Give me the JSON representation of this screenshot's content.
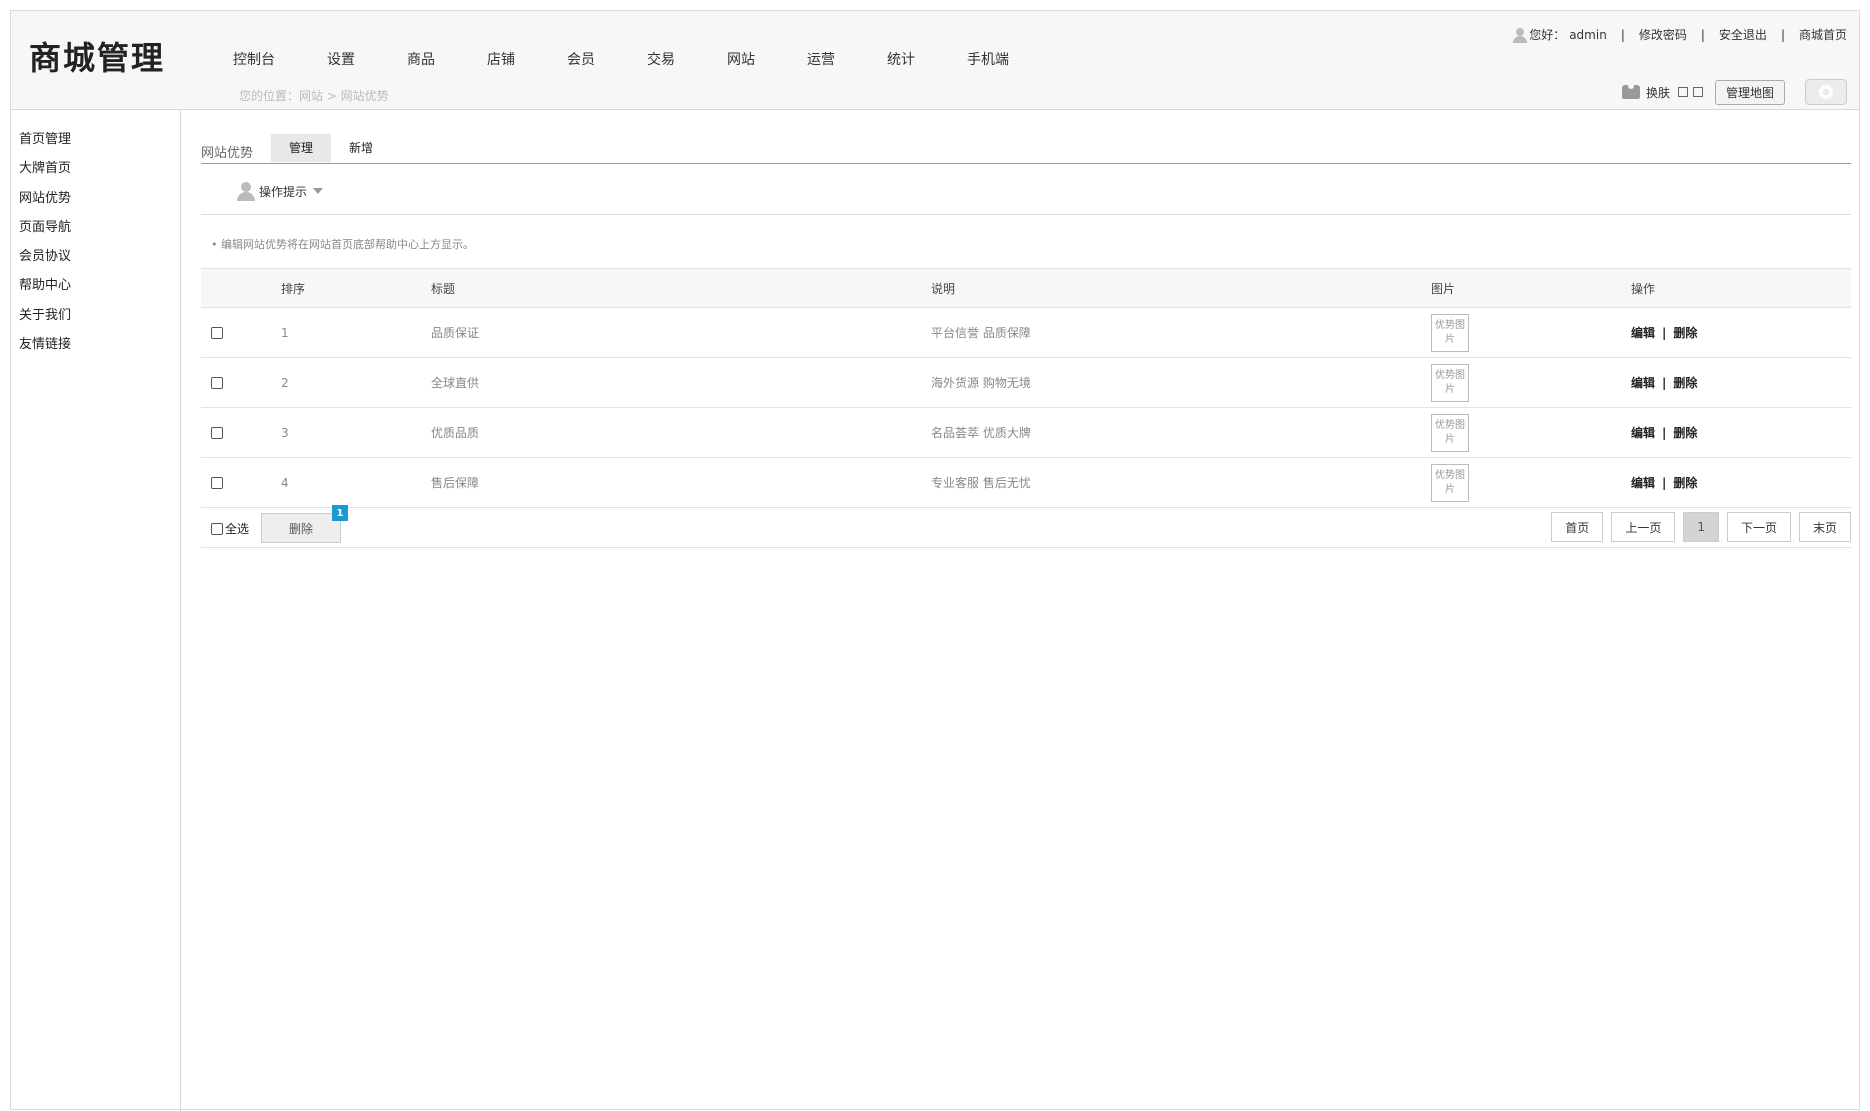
{
  "header": {
    "logo": "商城管理",
    "nav": [
      "控制台",
      "设置",
      "商品",
      "店铺",
      "会员",
      "交易",
      "网站",
      "运营",
      "统计",
      "手机端"
    ],
    "breadcrumb": "您的位置：网站 > 网站优势",
    "user": {
      "greeting": "您好：",
      "username": "admin",
      "change_password": "修改密码",
      "logout": "安全退出",
      "mall_home": "商城首页"
    },
    "tools": {
      "skin_label": "换肤",
      "sitemap_button": "管理地图"
    }
  },
  "sidebar": {
    "items": [
      "首页管理",
      "大牌首页",
      "网站优势",
      "页面导航",
      "会员协议",
      "帮助中心",
      "关于我们",
      "友情链接"
    ]
  },
  "main": {
    "tab_title": "网站优势",
    "tabs": [
      "管理",
      "新增"
    ],
    "tips_label": "操作提示",
    "tip_text": "• 编辑网站优势将在网站首页底部帮助中心上方显示。",
    "table": {
      "columns": [
        "排序",
        "标题",
        "说明",
        "图片",
        "操作"
      ],
      "rows": [
        {
          "sort": "1",
          "title": "品质保证",
          "desc": "平台信誉 品质保障",
          "img_alt": "优势图片"
        },
        {
          "sort": "2",
          "title": "全球直供",
          "desc": "海外货源 购物无境",
          "img_alt": "优势图片"
        },
        {
          "sort": "3",
          "title": "优质品质",
          "desc": "名品荟萃 优质大牌",
          "img_alt": "优势图片"
        },
        {
          "sort": "4",
          "title": "售后保障",
          "desc": "专业客服 售后无忧",
          "img_alt": "优势图片"
        }
      ],
      "ops": {
        "edit": "编辑",
        "delete": "删除"
      }
    },
    "footer": {
      "select_all": "全选",
      "delete_button": "删除",
      "badge": "1",
      "pager": {
        "first": "首页",
        "prev": "上一页",
        "current": "1",
        "next": "下一页",
        "last": "末页"
      }
    }
  }
}
